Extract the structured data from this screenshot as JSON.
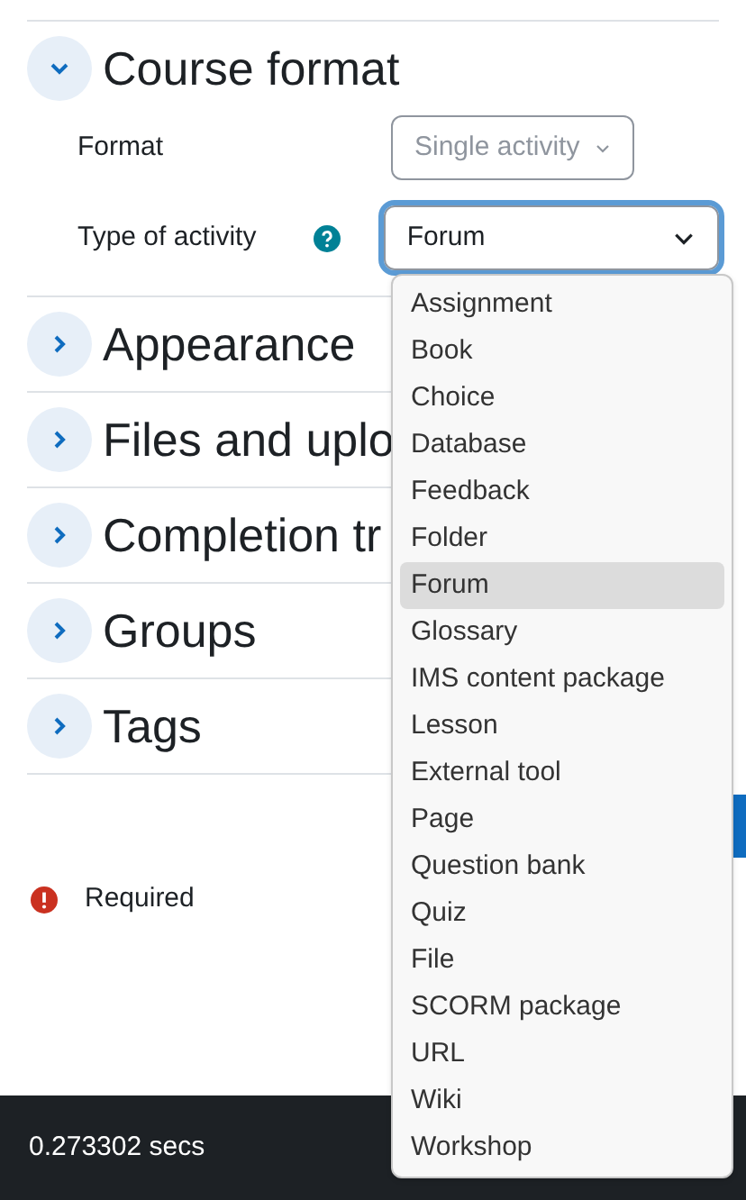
{
  "sections": [
    {
      "title": "Course format",
      "expanded": true
    },
    {
      "title": "Appearance",
      "expanded": false
    },
    {
      "title": "Files and uplo",
      "expanded": false
    },
    {
      "title": "Completion tr",
      "expanded": false
    },
    {
      "title": "Groups",
      "expanded": false
    },
    {
      "title": "Tags",
      "expanded": false
    }
  ],
  "fields": [
    {
      "label": "Format",
      "value": "Single activity",
      "disabled": true,
      "help": false,
      "focused": false
    },
    {
      "label": "Type of activity",
      "value": "Forum",
      "disabled": false,
      "help": true,
      "focused": true
    }
  ],
  "dropdown": {
    "options": [
      {
        "label": "Assignment",
        "selected": false
      },
      {
        "label": "Book",
        "selected": false
      },
      {
        "label": "Choice",
        "selected": false
      },
      {
        "label": "Database",
        "selected": false
      },
      {
        "label": "Feedback",
        "selected": false
      },
      {
        "label": "Folder",
        "selected": false
      },
      {
        "label": "Forum",
        "selected": true
      },
      {
        "label": "Glossary",
        "selected": false
      },
      {
        "label": "IMS content package",
        "selected": false
      },
      {
        "label": "Lesson",
        "selected": false
      },
      {
        "label": "External tool",
        "selected": false
      },
      {
        "label": "Page",
        "selected": false
      },
      {
        "label": "Question bank",
        "selected": false
      },
      {
        "label": "Quiz",
        "selected": false
      },
      {
        "label": "File",
        "selected": false
      },
      {
        "label": "SCORM package",
        "selected": false
      },
      {
        "label": "URL",
        "selected": false
      },
      {
        "label": "Wiki",
        "selected": false
      },
      {
        "label": "Workshop",
        "selected": false
      }
    ]
  },
  "required_note": "Required",
  "footer": {
    "timing": "0.273302 secs"
  }
}
